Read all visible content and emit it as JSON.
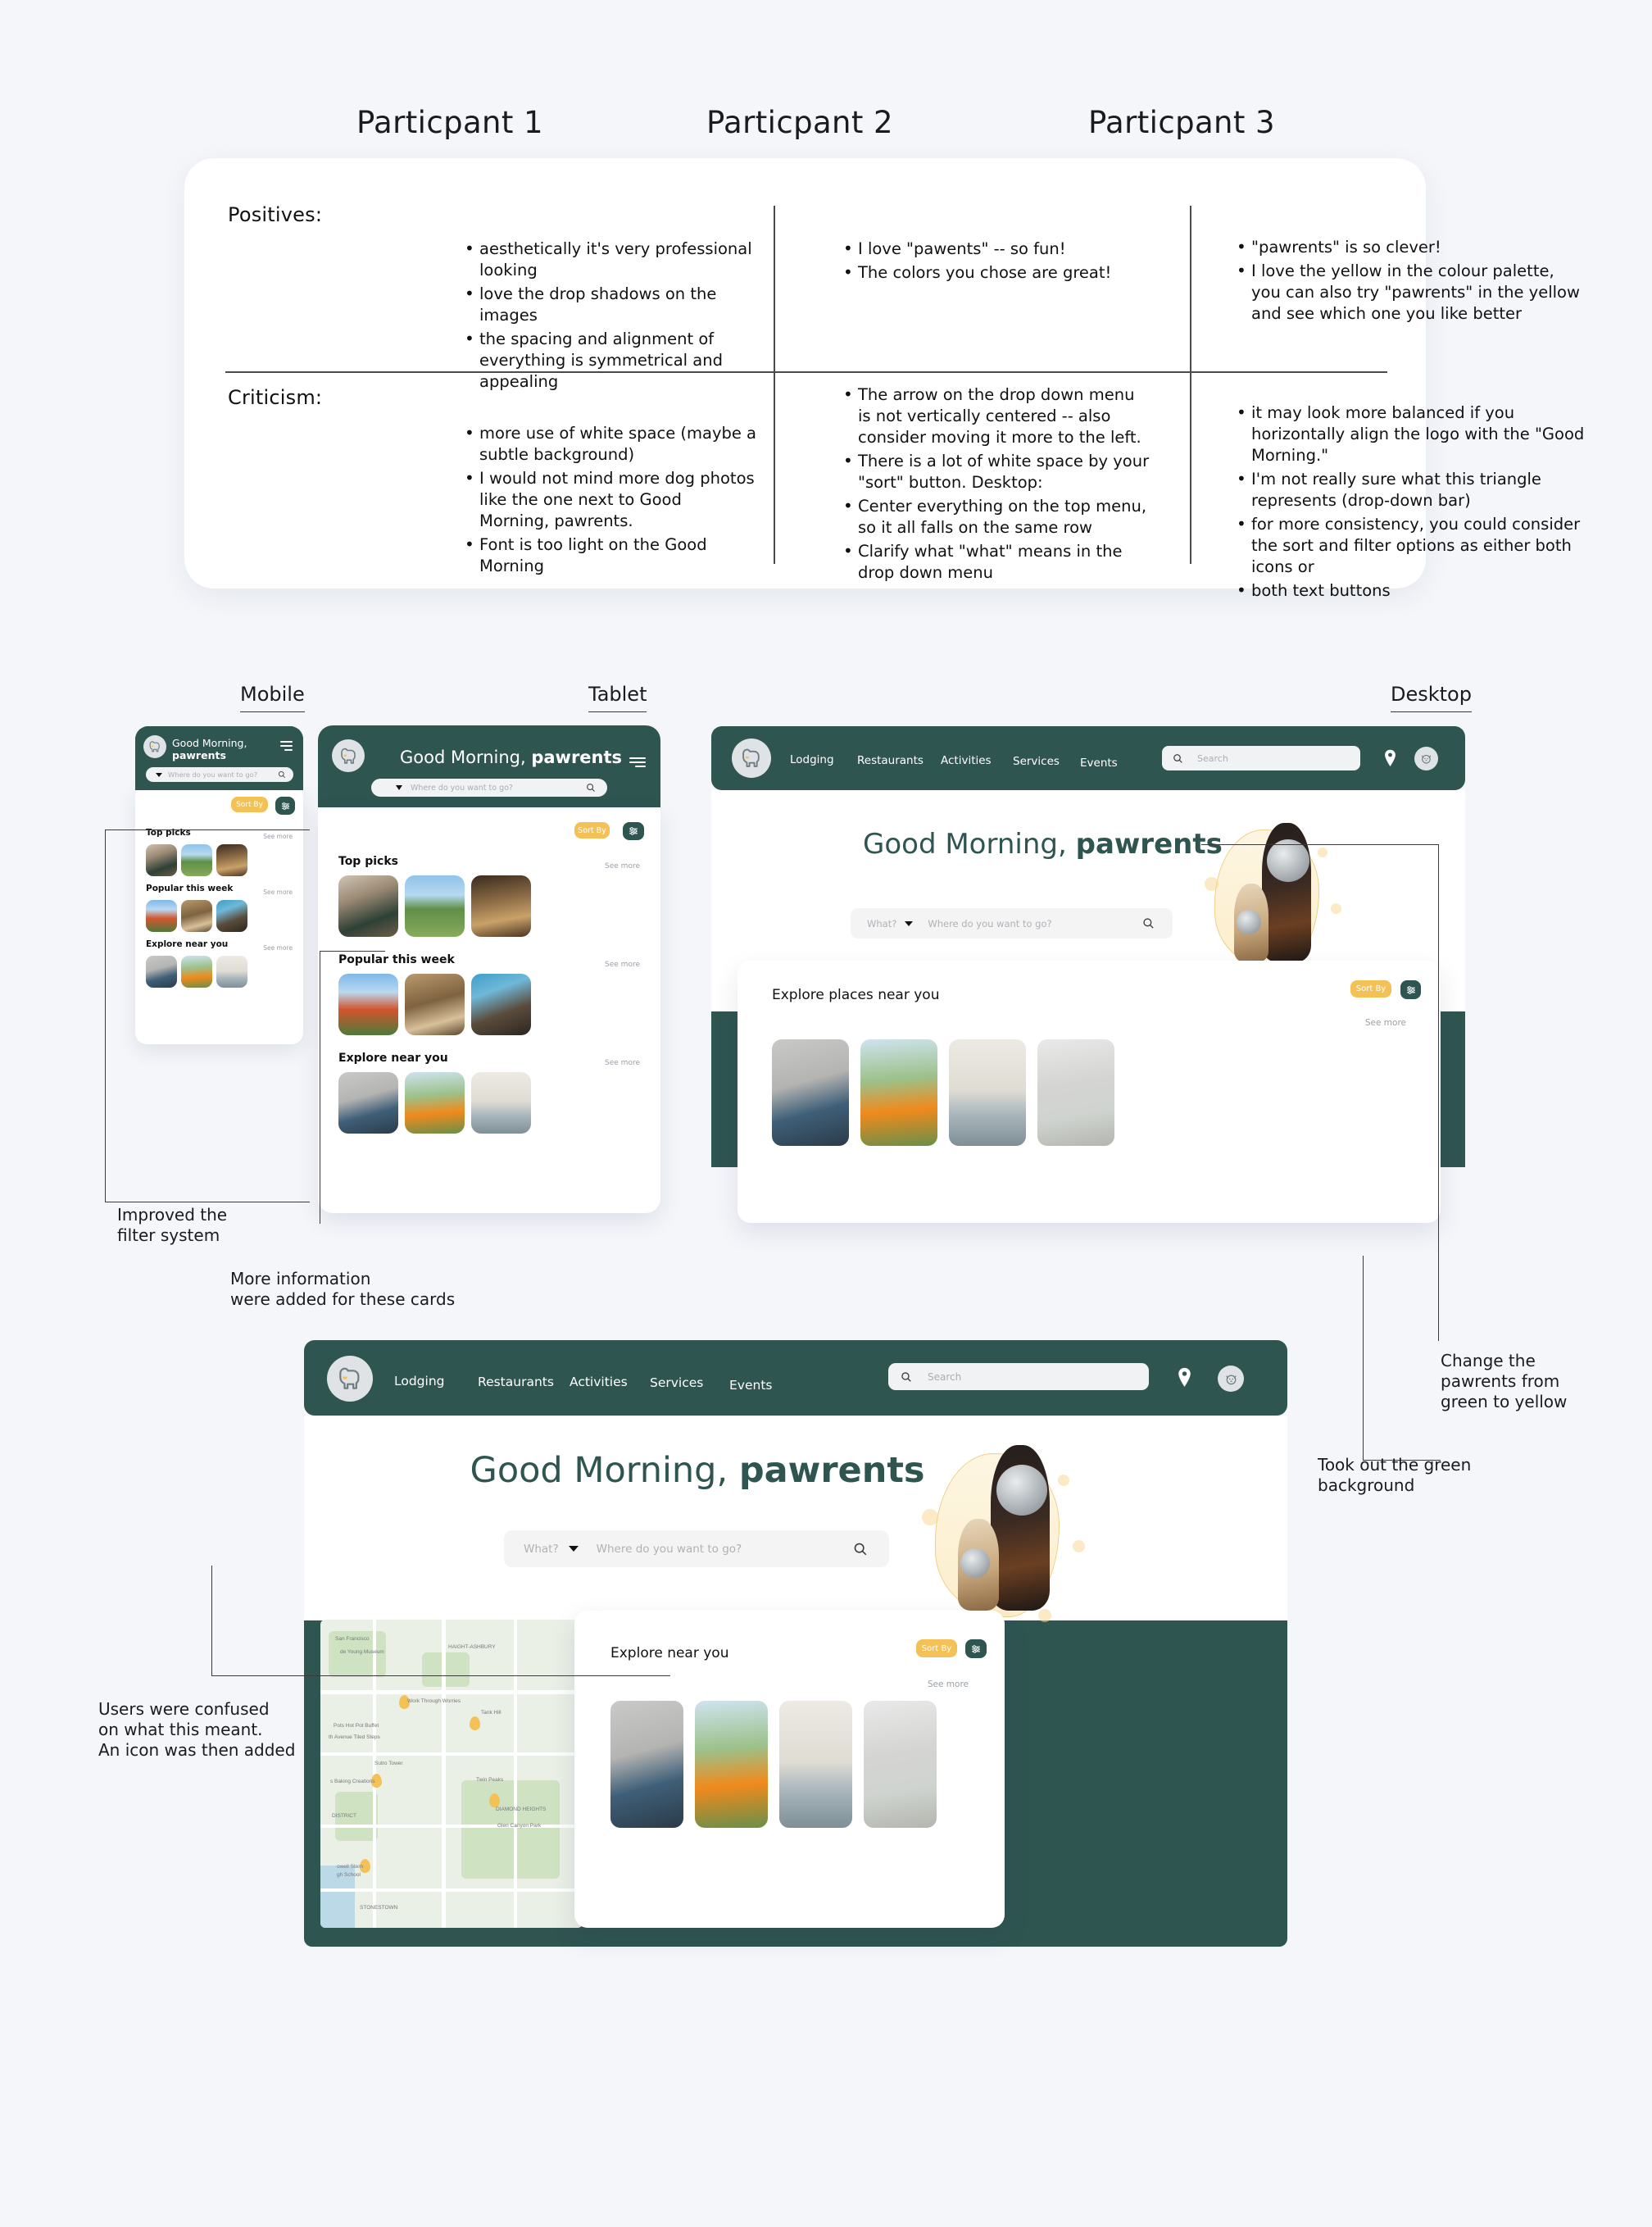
{
  "feedback": {
    "participants": [
      "Particpant 1",
      "Particpant 2",
      "Particpant 3"
    ],
    "section_positives": "Positives:",
    "section_criticism": "Criticism:",
    "columns": [
      {
        "positives": [
          "aesthetically it's very professional looking",
          "love the drop shadows on the images",
          "the spacing and alignment of everything is symmetrical and appealing"
        ],
        "criticism": [
          " more use of white space (maybe a subtle background)",
          "I would not mind more dog photos like the one next to Good Morning, pawrents.",
          "Font is too light on the Good Morning"
        ]
      },
      {
        "positives": [
          "I love \"pawents\" -- so fun!",
          "The colors you chose are great!"
        ],
        "criticism": [
          " The arrow on the drop down menu is not vertically centered -- also consider moving it more to the left.",
          "There is a lot of white space by your \"sort\" button. Desktop:",
          "Center everything on the top menu, so it all falls on the same row",
          "Clarify what \"what\" means in the drop down menu"
        ]
      },
      {
        "positives": [
          "\"pawrents\" is so clever!",
          "I love the yellow in the colour palette, you can also try \"pawrents\" in the yellow and see which one you like better"
        ],
        "criticism": [
          "it may look more balanced if you horizontally align the logo with the \"Good Morning.\"",
          "I'm not really sure what this triangle represents (drop-down bar)",
          "for more consistency, you could consider the sort and filter options as either both icons or",
          "both text buttons"
        ]
      }
    ]
  },
  "device_labels": {
    "mobile": "Mobile",
    "tablet": "Tablet",
    "desktop": "Desktop"
  },
  "brand": {
    "greeting": "Good Morning,",
    "greeting_inline": "Good Morning, ",
    "name": "pawrents",
    "logo_icon": "dog-logo-icon"
  },
  "mobile": {
    "search_placeholder": "Where do you want to go?",
    "sort_label": "Sort By",
    "filter_icon": "filter-sliders-icon",
    "menu_icon": "hamburger-menu-icon",
    "search_icon": "search-icon",
    "dropdown_icon": "caret-down-icon",
    "sections": [
      {
        "title": "Top picks",
        "see_more": "See more"
      },
      {
        "title": "Popular this week",
        "see_more": "See more"
      },
      {
        "title": "Explore near you",
        "see_more": "See more"
      }
    ]
  },
  "tablet": {
    "search_placeholder": "Where do you want to go?",
    "sort_label": "Sort By",
    "sections": [
      {
        "title": "Top picks",
        "see_more": "See more"
      },
      {
        "title": "Popular this week",
        "see_more": "See more"
      },
      {
        "title": "Explore near you",
        "see_more": "See more"
      }
    ]
  },
  "desktop_top": {
    "nav_items": [
      "Lodging",
      "Restaurants",
      "Activities",
      "Services",
      "Events"
    ],
    "search_placeholder": "Search",
    "location_icon": "location-pin-icon",
    "account_icon": "dog-avatar-icon",
    "hero_what_label": "What?",
    "hero_where_placeholder": "Where do you want to go?",
    "explore_title": "Explore places near you",
    "see_more": "See more",
    "sort_label": "Sort By",
    "filter_icon": "filter-sliders-icon"
  },
  "desktop_bottom": {
    "nav_items": [
      "Lodging",
      "Restaurants",
      "Activities",
      "Services",
      "Events"
    ],
    "search_placeholder": "Search",
    "hero_what_label": "What?",
    "hero_where_placeholder": "Where do you want to go?",
    "explore_title": "Explore near you",
    "see_more": "See more",
    "sort_label": "Sort By"
  },
  "map_labels": [
    "de Young Museum",
    "HAIGHT-ASHBURY",
    "Work Through Worries",
    "Tank Hill",
    "Pots Hot Pot Buffet",
    "th Avenue Tiled Steps",
    "Sutro Tower",
    "s Baking Creations",
    "Twin Peaks",
    "DISTRICT",
    "DIAMOND HEIGHTS",
    "Glen Canyon Park",
    "owell Stern",
    "gh School",
    "STONESTOWN",
    "San Francisco"
  ],
  "annotations": [
    {
      "id": "improved-filter",
      "text": "Improved the\nfilter system"
    },
    {
      "id": "more-info-cards",
      "text": "More information\nwere added for these cards"
    },
    {
      "id": "change-pawrents-color",
      "text": "Change the\npawrents from\ngreen to yellow"
    },
    {
      "id": "took-out-green-bg",
      "text": "Took out the green\nbackground"
    },
    {
      "id": "users-confused-icon",
      "text": "Users were confused\non what this meant.\nAn icon was then added"
    }
  ],
  "colors": {
    "page_bg": "#f4f6fa",
    "brand_green": "#2f5551",
    "brand_yellow": "#f3c156",
    "text_dark": "#1b1b1f",
    "muted": "#9aa0a6"
  }
}
